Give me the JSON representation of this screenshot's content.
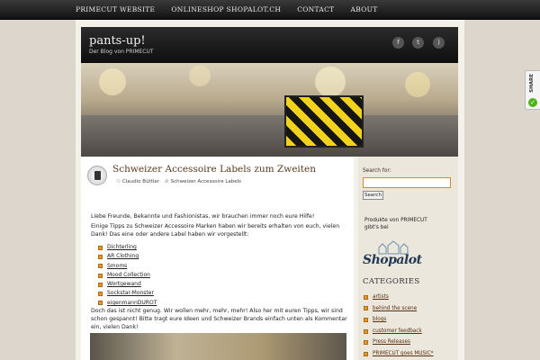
{
  "nav": {
    "items": [
      "PRIMECUT WEBSITE",
      "ONLINESHOP SHOPALOT.CH",
      "CONTACT",
      "ABOUT"
    ]
  },
  "header": {
    "title": "pants-up!",
    "subtitle": "Der Blog von PRIMECUT",
    "social": [
      "facebook-icon",
      "twitter-icon",
      "rss-icon"
    ]
  },
  "post": {
    "title": "Schweizer Accessoire Labels zum Zweiten",
    "author": "Claudio Büttler",
    "category": "Schweizer Accessoire Labels",
    "intro": "Liebe Freunde, Bekannte und Fashionistas, wir brauchen immer noch eure Hilfe!",
    "para": "Einige Tipps zu Schweizer Accessoire Marken haben wir bereits erhalten von euch, vielen Dank! Das eine oder andere Label haben wir vorgestellt:",
    "links": [
      "Dichterling",
      "AR Clothing",
      "Smoms",
      "Mood Collection",
      "Wortgewand",
      "Sockstar-Monster",
      "eigenmannDUROT"
    ],
    "outro": "Doch das ist nicht genug. Wir wollen mehr, mehr, mehr! Also her mit euren Tipps, wir sind schon gespannt! Bitte tragt eure Ideen und Schweizer Brands einfach unten als Kommentar ein, vielen Dank!"
  },
  "sidebar": {
    "search_label": "Search for:",
    "search_value": "",
    "search_button": "Search",
    "produkte": "Produkte von PRIMECUT gibt's bei",
    "logo": "Shopalot",
    "categories_title": "CATEGORIES",
    "categories": [
      "artists",
      "behind the scene",
      "blogs",
      "customer feedback",
      "Press Releases",
      "PRIMECUT goes MUSIC*"
    ]
  },
  "share": {
    "label": "SHARE"
  },
  "colors": {
    "accent": "#e19a2a",
    "title": "#5a3a1c",
    "header_bg": "#1a1a1a"
  }
}
